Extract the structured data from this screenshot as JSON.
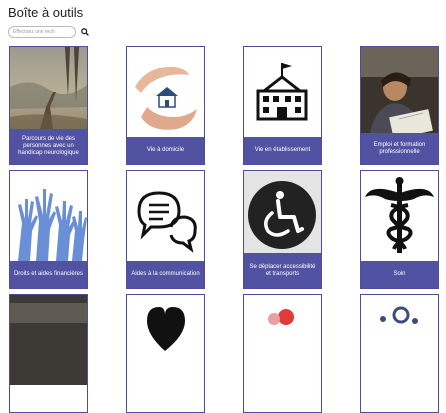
{
  "page": {
    "title": "Boîte à outils"
  },
  "search": {
    "placeholder": "Effectuez une rech",
    "icon": "search-icon"
  },
  "cards": [
    {
      "label": "Parcours de vie des personnes avec un handicap neurologique",
      "icon": "boardwalk-photo"
    },
    {
      "label": "Vie à domicile",
      "icon": "hands-house-icon"
    },
    {
      "label": "Vie en établissement",
      "icon": "building-icon"
    },
    {
      "label": "Emploi et formation professionnelle",
      "icon": "student-photo"
    },
    {
      "label": "Droits et aides financières",
      "icon": "raised-hands-icon"
    },
    {
      "label": "Aides à la communication",
      "icon": "speech-bubbles-icon"
    },
    {
      "label": "Se déplacer accessibilité et transports",
      "icon": "wheelchair-icon"
    },
    {
      "label": "Soin",
      "icon": "caduceus-icon"
    },
    {
      "label": "",
      "icon": "photo"
    },
    {
      "label": "",
      "icon": "heart-icon"
    },
    {
      "label": "",
      "icon": "people-icon"
    },
    {
      "label": "",
      "icon": "gears-icon"
    }
  ],
  "colors": {
    "caption_bg": "#5252a3",
    "card_border": "#4e4e9c"
  }
}
